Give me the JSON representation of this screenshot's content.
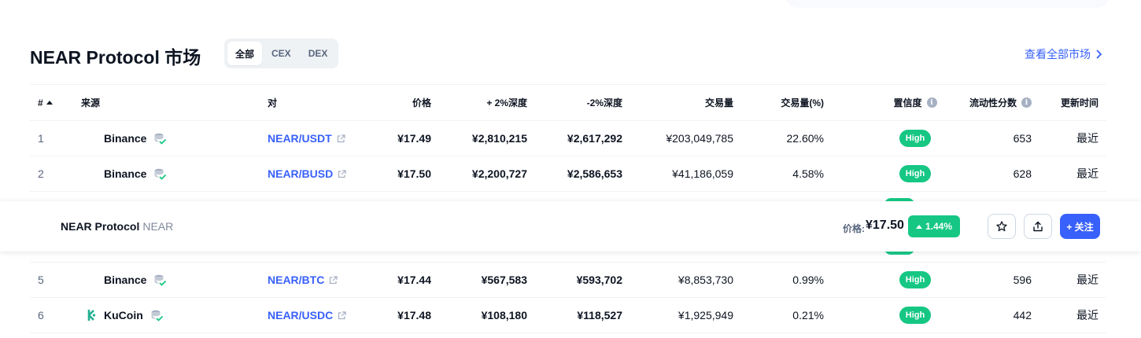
{
  "header": {
    "title": "NEAR Protocol 市场",
    "filters": [
      "全部",
      "CEX",
      "DEX"
    ],
    "active_filter": "全部",
    "view_all": "查看全部市场"
  },
  "table": {
    "columns": {
      "rank": "#",
      "source": "来源",
      "pair": "对",
      "price": "价格",
      "plus_depth": "+ 2%深度",
      "minus_depth": "-2%深度",
      "volume": "交易量",
      "volume_pct": "交易量(%)",
      "confidence": "置信度",
      "liquidity": "流动性分数",
      "updated": "更新时间"
    },
    "rows": [
      {
        "rank": "1",
        "source": "Binance",
        "pair": "NEAR/USDT",
        "price": "¥17.49",
        "plus_depth": "¥2,810,215",
        "minus_depth": "¥2,617,292",
        "volume": "¥203,049,785",
        "volume_pct": "22.60%",
        "confidence": "High",
        "liquidity": "653",
        "updated": "最近"
      },
      {
        "rank": "2",
        "source": "Binance",
        "pair": "NEAR/BUSD",
        "price": "¥17.50",
        "plus_depth": "¥2,200,727",
        "minus_depth": "¥2,586,653",
        "volume": "¥41,186,059",
        "volume_pct": "4.58%",
        "confidence": "High",
        "liquidity": "628",
        "updated": "最近"
      },
      {
        "rank": "5",
        "source": "Binance",
        "pair": "NEAR/BTC",
        "price": "¥17.44",
        "plus_depth": "¥567,583",
        "minus_depth": "¥593,702",
        "volume": "¥8,853,730",
        "volume_pct": "0.99%",
        "confidence": "High",
        "liquidity": "596",
        "updated": "最近"
      },
      {
        "rank": "6",
        "source": "KuCoin",
        "pair": "NEAR/USDC",
        "price": "¥17.48",
        "plus_depth": "¥108,180",
        "minus_depth": "¥118,527",
        "volume": "¥1,925,949",
        "volume_pct": "0.21%",
        "confidence": "High",
        "liquidity": "442",
        "updated": "最近"
      }
    ]
  },
  "sticky": {
    "name": "NEAR Protocol",
    "symbol": "NEAR",
    "price_label": "价格:",
    "price": "¥17.50",
    "change": "1.44%",
    "follow": "+ 关注"
  },
  "colors": {
    "accent": "#3861fb",
    "positive": "#16c784",
    "kucoin": "#23af91",
    "binance_verified": "#a6b0c3"
  },
  "icons": {
    "sort": "sort-up-icon",
    "info": "info-icon",
    "verified": "verified-exchange-icon",
    "external": "external-link-icon",
    "star": "star-icon",
    "share": "share-icon",
    "kucoin": "kucoin-logo"
  }
}
